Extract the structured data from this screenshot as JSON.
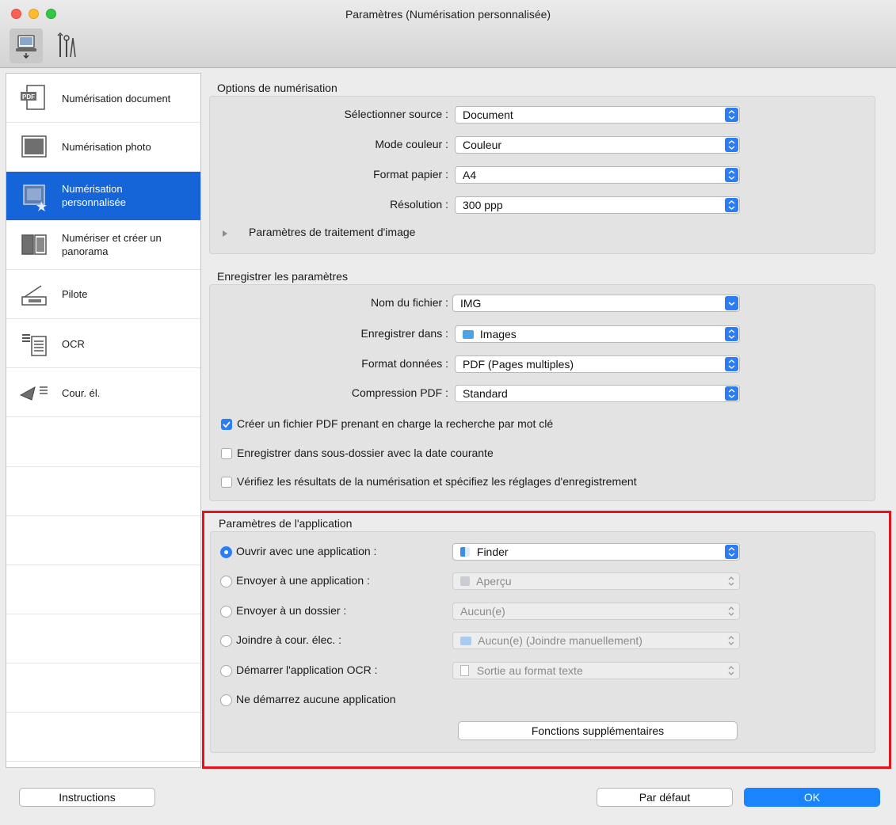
{
  "window": {
    "title": "Paramètres (Numérisation personnalisée)"
  },
  "toolbar": {
    "tabs": [
      "scan-tab",
      "general-settings-tab"
    ]
  },
  "sidebar": {
    "items": [
      {
        "label": "Numérisation document"
      },
      {
        "label": "Numérisation photo"
      },
      {
        "label_line1": "Numérisation",
        "label_line2": "personnalisée"
      },
      {
        "label_line1": "Numériser et créer un",
        "label_line2": "panorama"
      },
      {
        "label": "Pilote"
      },
      {
        "label": "OCR"
      },
      {
        "label": "Cour. él."
      }
    ]
  },
  "scan_options": {
    "title": "Options de numérisation",
    "rows": [
      {
        "label": "Sélectionner source :",
        "value": "Document"
      },
      {
        "label": "Mode couleur :",
        "value": "Couleur"
      },
      {
        "label": "Format papier :",
        "value": "A4"
      },
      {
        "label": "Résolution :",
        "value": "300 ppp"
      }
    ],
    "image_processing": "Paramètres de traitement d'image"
  },
  "save_settings": {
    "title": "Enregistrer les paramètres",
    "rows": [
      {
        "label": "Nom du fichier :",
        "value": "IMG"
      },
      {
        "label": "Enregistrer dans :",
        "value": "Images"
      },
      {
        "label": "Format données :",
        "value": "PDF (Pages multiples)"
      },
      {
        "label": "Compression PDF :",
        "value": "Standard"
      }
    ],
    "checkboxes": [
      {
        "label": "Créer un fichier PDF prenant en charge la recherche par mot clé",
        "checked": true
      },
      {
        "label": "Enregistrer dans sous-dossier avec la date courante",
        "checked": false
      },
      {
        "label": "Vérifiez les résultats de la numérisation et spécifiez les réglages d'enregistrement",
        "checked": false
      }
    ]
  },
  "app_settings": {
    "title": "Paramètres de l'application",
    "options": [
      {
        "label": "Ouvrir avec une application :",
        "value": "Finder",
        "selected": true
      },
      {
        "label": "Envoyer à une application :",
        "value": "Aperçu",
        "selected": false
      },
      {
        "label": "Envoyer à un dossier :",
        "value": "Aucun(e)",
        "selected": false
      },
      {
        "label": "Joindre à cour. élec. :",
        "value": "Aucun(e) (Joindre manuellement)",
        "selected": false
      },
      {
        "label": "Démarrer l'application OCR :",
        "value": "Sortie au format texte",
        "selected": false
      },
      {
        "label": "Ne démarrez aucune application",
        "selected": false
      }
    ],
    "more_functions": "Fonctions supplémentaires"
  },
  "footer": {
    "instructions": "Instructions",
    "defaults": "Par défaut",
    "ok": "OK"
  },
  "colors": {
    "accent": "#1a84ff",
    "selection": "#1665d8",
    "highlight_frame": "#e3131b"
  }
}
